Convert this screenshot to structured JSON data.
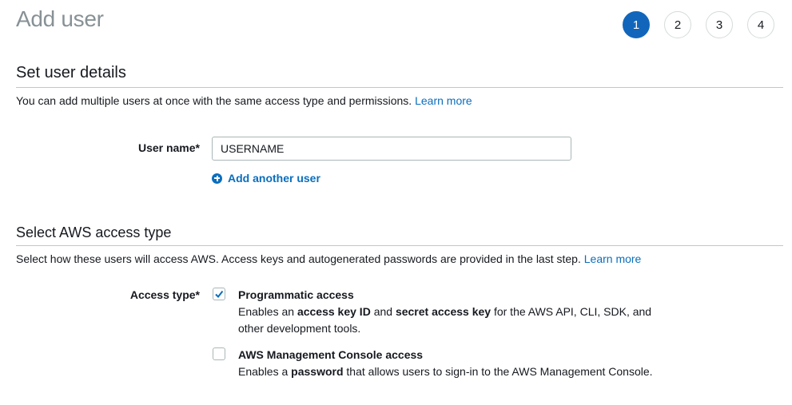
{
  "page": {
    "title": "Add user"
  },
  "steps": [
    {
      "label": "1",
      "active": true
    },
    {
      "label": "2",
      "active": false
    },
    {
      "label": "3",
      "active": false
    },
    {
      "label": "4",
      "active": false
    }
  ],
  "user_details": {
    "title": "Set user details",
    "description": "You can add multiple users at once with the same access type and permissions.",
    "learn_more": "Learn more",
    "user_name_label": "User name*",
    "user_name_value": "USERNAME",
    "add_another_user": "Add another user"
  },
  "access_type": {
    "title": "Select AWS access type",
    "description": "Select how these users will access AWS. Access keys and autogenerated passwords are provided in the last step.",
    "learn_more": "Learn more",
    "label": "Access type*",
    "options": [
      {
        "title": "Programmatic access",
        "checked": true,
        "desc_parts": [
          "Enables an ",
          "access key ID",
          " and ",
          "secret access key",
          " for the AWS API, CLI, SDK, and other development tools."
        ]
      },
      {
        "title": "AWS Management Console access",
        "checked": false,
        "desc_parts": [
          "Enables a ",
          "password",
          " that allows users to sign-in to the AWS Management Console."
        ]
      }
    ]
  },
  "colors": {
    "accent": "#1166bb",
    "link": "#0a6ebd"
  }
}
